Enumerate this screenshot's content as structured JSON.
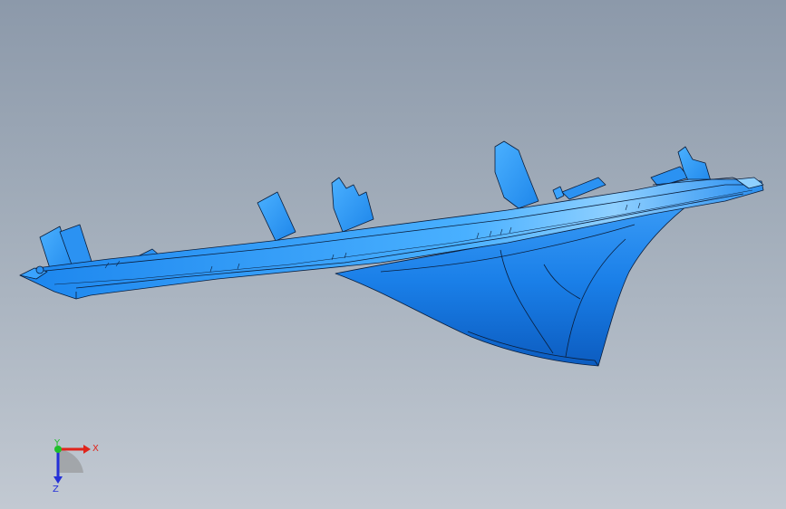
{
  "viewport": {
    "background_top": "#8c99aa",
    "background_bottom": "#c2c9d2"
  },
  "model": {
    "color_main": "#1a7fe8",
    "color_light": "#3fa6ff",
    "color_dark": "#0b58b8",
    "edge_color": "#0a1e3c"
  },
  "triad": {
    "x_label": "X",
    "y_label": "Y",
    "z_label": "Z",
    "x_color": "#e0241b",
    "y_color": "#1fbf2a",
    "z_color": "#2430d8"
  }
}
